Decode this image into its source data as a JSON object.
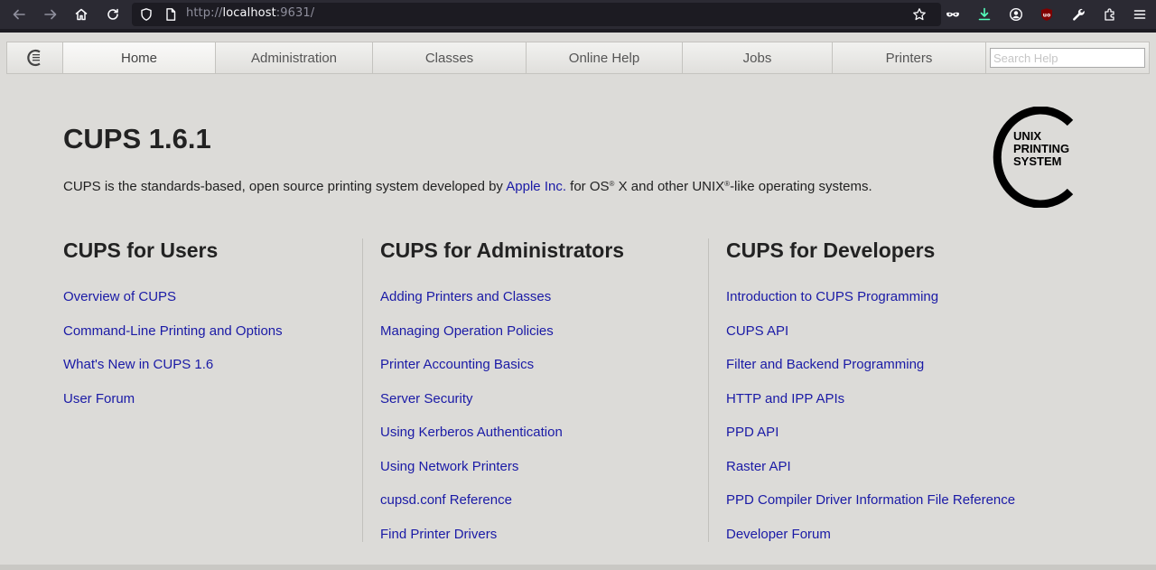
{
  "browser": {
    "url_prefix": "http://",
    "url_host": "localhost",
    "url_suffix": ":9631/",
    "icons": [
      "back-icon",
      "forward-icon",
      "home-icon",
      "reload-icon",
      "shield-icon",
      "page-icon",
      "bookmark-star-icon",
      "mask-icon",
      "download-icon",
      "account-icon",
      "ublock-icon",
      "wrench-icon",
      "extensions-icon",
      "menu-icon"
    ]
  },
  "nav": {
    "tabs": [
      "Home",
      "Administration",
      "Classes",
      "Online Help",
      "Jobs",
      "Printers"
    ],
    "active_tab": "Home",
    "search_placeholder": "Search Help"
  },
  "header": {
    "title": "CUPS 1.6.1",
    "intro_before": "CUPS is the standards-based, open source printing system developed by ",
    "intro_link": "Apple Inc.",
    "intro_mid1": " for OS",
    "intro_reg1": "®",
    "intro_mid2": " X and other UNIX",
    "intro_reg2": "®",
    "intro_after": "-like operating systems.",
    "logo_lines": [
      "UNIX",
      "PRINTING",
      "SYSTEM"
    ]
  },
  "columns": [
    {
      "heading": "CUPS for Users",
      "links": [
        "Overview of CUPS",
        "Command-Line Printing and Options",
        "What's New in CUPS 1.6",
        "User Forum"
      ]
    },
    {
      "heading": "CUPS for Administrators",
      "links": [
        "Adding Printers and Classes",
        "Managing Operation Policies",
        "Printer Accounting Basics",
        "Server Security",
        "Using Kerberos Authentication",
        "Using Network Printers",
        "cupsd.conf Reference",
        "Find Printer Drivers"
      ]
    },
    {
      "heading": "CUPS for Developers",
      "links": [
        "Introduction to CUPS Programming",
        "CUPS API",
        "Filter and Backend Programming",
        "HTTP and IPP APIs",
        "PPD API",
        "Raster API",
        "PPD Compiler Driver Information File Reference",
        "Developer Forum"
      ]
    }
  ],
  "colors": {
    "link": "#1a1aa6",
    "page_bg": "#dcdbd8",
    "toolbar_bg": "#2b2a33",
    "download_accent": "#54ffbd",
    "ublock_red": "#800000"
  }
}
